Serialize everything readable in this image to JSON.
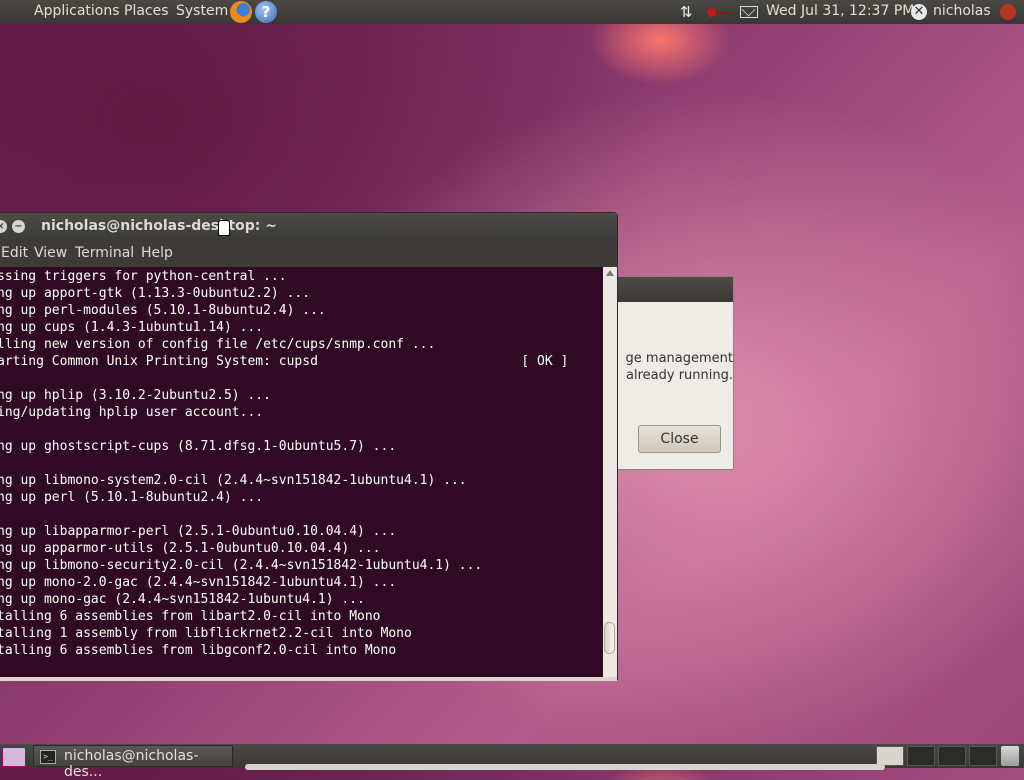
{
  "top_panel": {
    "menus": [
      "Applications",
      "Places",
      "System"
    ],
    "help_glyph": "?",
    "network_glyph": "⇅",
    "clock": "Wed Jul 31, 12:37 PM",
    "user": "nicholas",
    "user_glyph": "✕",
    "icons": [
      "firefox-icon",
      "help-icon",
      "network-icon",
      "record-icon",
      "mail-icon",
      "user-icon",
      "power-icon"
    ]
  },
  "dialog": {
    "line1": "ge management",
    "line2": "already running.",
    "close_label": "Close"
  },
  "terminal": {
    "title": "nicholas@nicholas-desktop: ~",
    "close_glyph": "×",
    "minimize_glyph": "−",
    "menu": [
      "Edit",
      "View",
      "Terminal",
      "Help"
    ],
    "lines": [
      "ssing triggers for python-central ...",
      "ng up apport-gtk (1.13.3-0ubuntu2.2) ...",
      "ng up perl-modules (5.10.1-8ubuntu2.4) ...",
      "ng up cups (1.4.3-1ubuntu1.14) ...",
      "lling new version of config file /etc/cups/snmp.conf ...",
      "arting Common Unix Printing System: cupsd                          [ OK ]",
      "",
      "ng up hplip (3.10.2-2ubuntu2.5) ...",
      "ing/updating hplip user account...",
      "",
      "ng up ghostscript-cups (8.71.dfsg.1-0ubuntu5.7) ...",
      "",
      "ng up libmono-system2.0-cil (2.4.4~svn151842-1ubuntu4.1) ...",
      "ng up perl (5.10.1-8ubuntu2.4) ...",
      "",
      "ng up libapparmor-perl (2.5.1-0ubuntu0.10.04.4) ...",
      "ng up apparmor-utils (2.5.1-0ubuntu0.10.04.4) ...",
      "ng up libmono-security2.0-cil (2.4.4~svn151842-1ubuntu4.1) ...",
      "ng up mono-2.0-gac (2.4.4~svn151842-1ubuntu4.1) ...",
      "ng up mono-gac (2.4.4~svn151842-1ubuntu4.1) ...",
      "talling 6 assemblies from libart2.0-cil into Mono",
      "talling 1 assembly from libflickrnet2.2-cil into Mono",
      "talling 6 assemblies from libgconf2.0-cil into Mono"
    ]
  },
  "bottom_panel": {
    "task_label": "nicholas@nicholas-des...",
    "task_icon_glyph": ">_",
    "workspaces": 4,
    "active_workspace": 0
  },
  "colors": {
    "terminal_bg": "#300a24",
    "panel_bg": "#3c3b37",
    "accent": "#dd4814"
  }
}
